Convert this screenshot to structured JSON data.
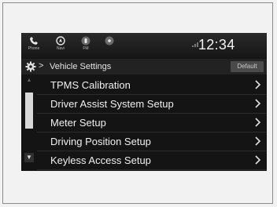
{
  "topbar": {
    "icons": [
      {
        "icon": "phone-icon",
        "label": "Phone"
      },
      {
        "icon": "navi-icon",
        "label": "Navi"
      },
      {
        "icon": "fm-icon",
        "label": "FM"
      },
      {
        "icon": "media-icon",
        "label": ""
      }
    ],
    "time": "12:34"
  },
  "header": {
    "icon": "gear-icon",
    "title": "Vehicle Settings",
    "default_label": "Default"
  },
  "menu": {
    "items": [
      {
        "label": "TPMS Calibration"
      },
      {
        "label": "Driver Assist System Setup"
      },
      {
        "label": "Meter Setup"
      },
      {
        "label": "Driving Position Setup"
      },
      {
        "label": "Keyless Access Setup"
      }
    ]
  }
}
